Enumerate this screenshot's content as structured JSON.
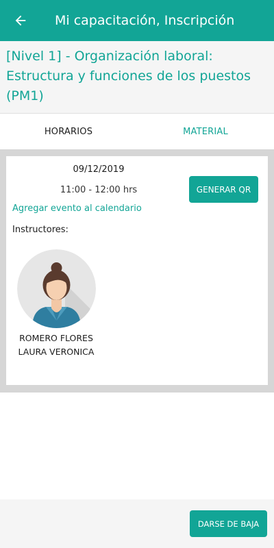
{
  "appbar": {
    "title": "Mi capacitación, Inscripción",
    "back_icon": "arrow-left-icon",
    "color": "#12a596"
  },
  "course": {
    "title": "[Nivel 1] - Organización laboral: Estructura y funciones de los puestos (PM1)"
  },
  "tabs": [
    {
      "label": "HORARIOS",
      "selected": true
    },
    {
      "label": "MATERIAL",
      "selected": false
    }
  ],
  "schedule": {
    "date": "09/12/2019",
    "time": "11:00 - 12:00 hrs",
    "qr_button": "GENERAR QR",
    "calendar_link": "Agregar evento al calendario",
    "instructors_label": "Instructores:",
    "instructors": [
      {
        "name": "ROMERO FLORES LAURA VERONICA",
        "avatar_icon": "female-avatar-icon"
      }
    ]
  },
  "footer": {
    "unsubscribe_button": "DARSE DE BAJA"
  }
}
